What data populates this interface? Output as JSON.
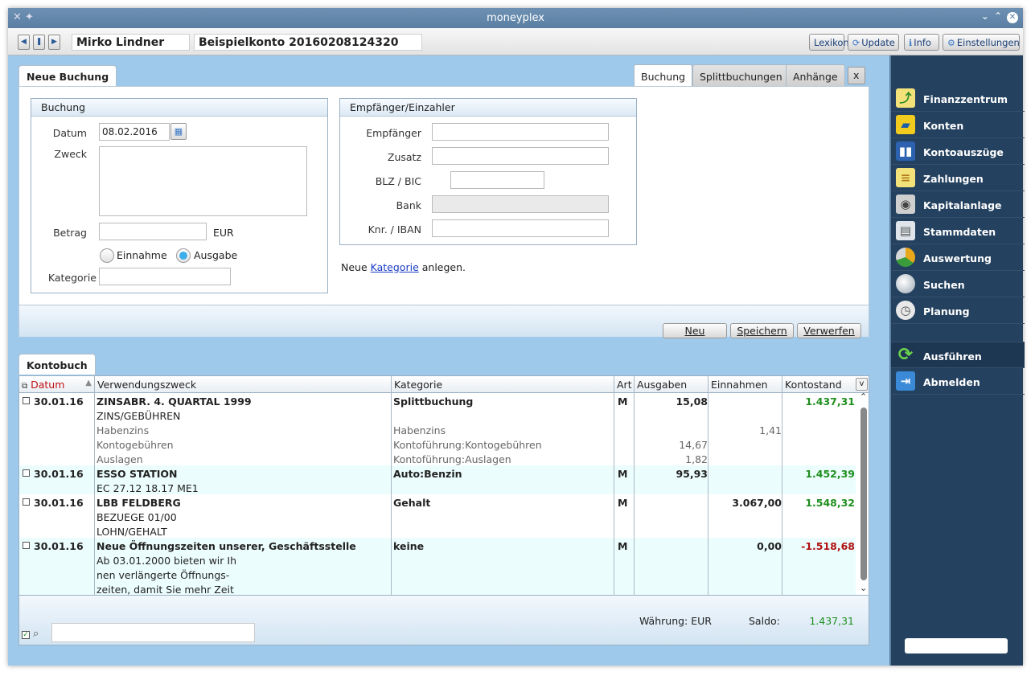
{
  "app": {
    "title": "moneyplex"
  },
  "header": {
    "user_name": "Mirko Lindner",
    "account_name": "Beispielkonto 20160208124320",
    "buttons": {
      "lexikon": "Lexikon",
      "update": "Update",
      "info": "Info",
      "settings": "Einstellungen"
    }
  },
  "form": {
    "tab_label": "Neue Buchung",
    "tabs": [
      "Buchung",
      "Splittbuchungen",
      "Anhänge"
    ],
    "close_label": "x",
    "booking": {
      "title": "Buchung",
      "datum_label": "Datum",
      "datum_value": "08.02.2016",
      "zweck_label": "Zweck",
      "betrag_label": "Betrag",
      "currency": "EUR",
      "einnahme_label": "Einnahme",
      "ausgabe_label": "Ausgabe",
      "kategorie_label": "Kategorie"
    },
    "recipient": {
      "title": "Empfänger/Einzahler",
      "empfaenger_label": "Empfänger",
      "zusatz_label": "Zusatz",
      "blz_label": "BLZ / BIC",
      "bank_label": "Bank",
      "knr_label": "Knr. / IBAN"
    },
    "category_hint": {
      "before": "Neue ",
      "link": "Kategorie",
      "after": " anlegen."
    },
    "actions": {
      "neu": "Neu",
      "speichern": "Speichern",
      "verwerfen": "Verwerfen"
    }
  },
  "ledger": {
    "tab_label": "Kontobuch",
    "columns": [
      "Datum",
      "Verwendungszweck",
      "Kategorie",
      "Art",
      "Ausgaben",
      "Einnahmen",
      "Kontostand"
    ],
    "rows": [
      {
        "date": "30.01.16",
        "title": "ZINSABR. 4. QUARTAL 1999",
        "lines": [
          "ZINS/GEBÜHREN"
        ],
        "category": "Splittbuchung",
        "art": "M",
        "ausgaben": "15,08",
        "einnahmen": "",
        "balance": "1.437,31",
        "splits": [
          {
            "text": "Habenzins",
            "category": "Habenzins",
            "ausgaben": "",
            "einnahmen": "1,41"
          },
          {
            "text": "Kontogebühren",
            "category": "Kontoführung:Kontogebühren",
            "ausgaben": "14,67",
            "einnahmen": ""
          },
          {
            "text": "Auslagen",
            "category": "Kontoführung:Auslagen",
            "ausgaben": "1,82",
            "einnahmen": ""
          }
        ]
      },
      {
        "date": "30.01.16",
        "title": "ESSO STATION",
        "lines": [
          "EC 27.12 18.17 ME1"
        ],
        "category": "Auto:Benzin",
        "art": "M",
        "ausgaben": "95,93",
        "einnahmen": "",
        "balance": "1.452,39",
        "splits": []
      },
      {
        "date": "30.01.16",
        "title": "LBB FELDBERG",
        "lines": [
          "BEZUEGE 01/00",
          "LOHN/GEHALT"
        ],
        "category": "Gehalt",
        "art": "M",
        "ausgaben": "",
        "einnahmen": "3.067,00",
        "balance": "1.548,32",
        "splits": []
      },
      {
        "date": "30.01.16",
        "title": "Neue Öffnungszeiten unserer, Geschäftsstelle",
        "lines": [
          "Ab 03.01.2000 bieten wir Ih",
          "nen verlängerte Öffnungs-",
          "zeiten, damit Sie mehr Zeit"
        ],
        "category": "keine",
        "art": "M",
        "ausgaben": "",
        "einnahmen": "0,00",
        "balance": "-1.518,68",
        "splits": []
      }
    ],
    "footer": {
      "currency_label": "Währung: EUR",
      "saldo_label": "Saldo:",
      "saldo_value": "1.437,31"
    }
  },
  "sidebar": {
    "items": [
      {
        "label": "Finanzzentrum",
        "icon": "chart-icon"
      },
      {
        "label": "Konten",
        "icon": "folder-icon"
      },
      {
        "label": "Kontoauszüge",
        "icon": "binder-icon"
      },
      {
        "label": "Zahlungen",
        "icon": "payment-icon"
      },
      {
        "label": "Kapitalanlage",
        "icon": "safe-icon"
      },
      {
        "label": "Stammdaten",
        "icon": "book-icon"
      },
      {
        "label": "Auswertung",
        "icon": "pie-icon"
      },
      {
        "label": "Suchen",
        "icon": "magnifier-icon"
      },
      {
        "label": "Planung",
        "icon": "clock-icon"
      }
    ],
    "execute": "Ausführen",
    "logout": "Abmelden"
  }
}
